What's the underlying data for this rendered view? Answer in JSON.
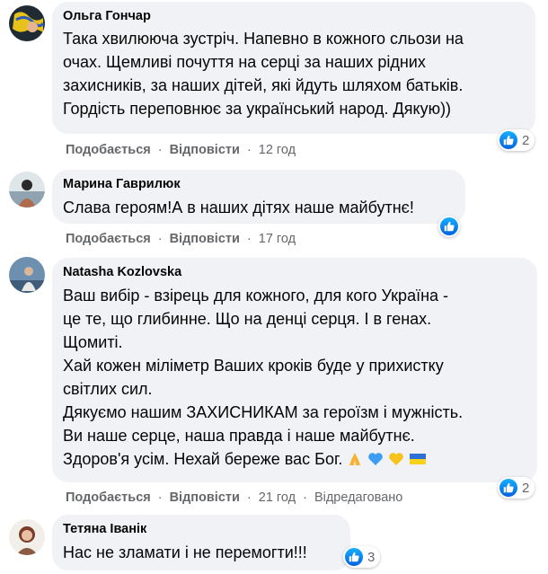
{
  "comments": [
    {
      "author": "Ольга Гончар",
      "lines": [
        "Така хвилююча зустріч. Напевно в кожного сльози на",
        "очах. Щемливі почуття на серці за наших рідних",
        "захисників, за наших дітей, які йдуть шляхом батьків.",
        "Гордість переповнює за український народ. Дякую))"
      ],
      "like_label": "Подобається",
      "reply_label": "Відповісти",
      "time": "12 год",
      "reaction_count": "2"
    },
    {
      "author": "Марина Гаврилюк",
      "lines": [
        "Слава героям!А в наших дітях наше майбутнє!"
      ],
      "like_label": "Подобається",
      "reply_label": "Відповісти",
      "time": "17 год",
      "reaction_count": ""
    },
    {
      "author": "Natasha Kozlovska",
      "lines": [
        "Ваш вибір - взірець для кожного, для кого Україна -",
        "це те, що глибинне. Що на денці серця. І в генах.",
        "Щомиті.",
        "Хай кожен міліметр Ваших кроків буде у прихистку",
        "світлих сил.",
        "Дякуємо нашим ЗАХИСНИКАМ за героїзм і мужність.",
        "Ви наше серце, наша правда і наше майбутнє.",
        "Здоров'я усім. Нехай береже вас Бог."
      ],
      "like_label": "Подобається",
      "reply_label": "Відповісти",
      "time": "21 год",
      "edited_label": "Відредаговано",
      "reaction_count": "2"
    },
    {
      "author": "Тетяна Іванік",
      "lines": [
        "Нас не зламати і не перемогти!!!"
      ],
      "reaction_count": "3"
    }
  ],
  "colors": {
    "bubble_bg": "#f0f2f5",
    "meta_text": "#65676b",
    "like_blue": "#1877f2"
  },
  "icons": {
    "like": "thumbs-up-icon",
    "emoji_sequence": [
      "folded-hands-emoji",
      "blue-heart-emoji",
      "yellow-heart-emoji",
      "ukraine-flag-emoji"
    ]
  }
}
